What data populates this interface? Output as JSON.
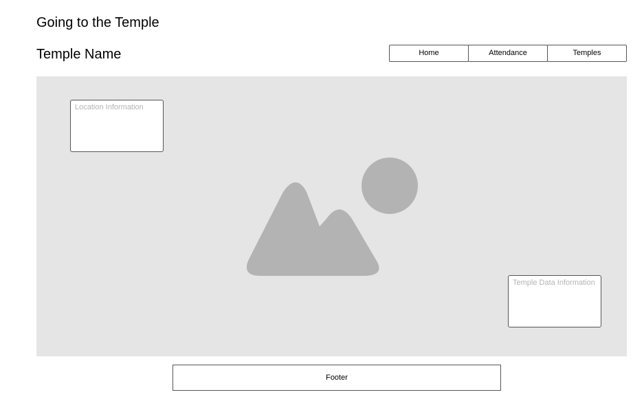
{
  "header": {
    "site_title": "Going to the Temple",
    "page_heading": "Temple Name"
  },
  "nav": {
    "items": [
      {
        "label": "Home"
      },
      {
        "label": "Attendance"
      },
      {
        "label": "Temples"
      }
    ]
  },
  "hero": {
    "image_icon": "image-placeholder-icon",
    "location_box": {
      "placeholder": "Location Information"
    },
    "temple_data_box": {
      "placeholder": "Temple Data Information"
    }
  },
  "footer": {
    "label": "Footer"
  },
  "colors": {
    "background": "#ffffff",
    "placeholder_panel": "#e5e5e5",
    "placeholder_graphic": "#b3b3b3",
    "placeholder_text": "#b3b3b3",
    "border": "#555555"
  }
}
